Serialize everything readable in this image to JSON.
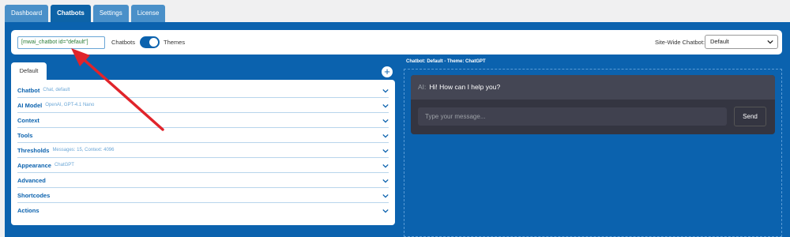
{
  "tabs": [
    {
      "label": "Dashboard",
      "active": false
    },
    {
      "label": "Chatbots",
      "active": true
    },
    {
      "label": "Settings",
      "active": false
    },
    {
      "label": "License",
      "active": false
    }
  ],
  "topbar": {
    "shortcode": "[mwai_chatbot id=\"default\"]",
    "chatbots_label": "Chatbots",
    "themes_label": "Themes",
    "sitewide_label": "Site-Wide Chatbot:",
    "sitewide_value": "Default"
  },
  "editor": {
    "active_tab": "Default",
    "add_symbol": "+",
    "sections": [
      {
        "title": "Chatbot",
        "subtitle": "Chat, default"
      },
      {
        "title": "AI Model",
        "subtitle": "OpenAI, GPT-4.1 Nano"
      },
      {
        "title": "Context",
        "subtitle": ""
      },
      {
        "title": "Tools",
        "subtitle": ""
      },
      {
        "title": "Thresholds",
        "subtitle": "Messages: 15, Context: 4096"
      },
      {
        "title": "Appearance",
        "subtitle": "ChatGPT"
      },
      {
        "title": "Advanced",
        "subtitle": ""
      },
      {
        "title": "Shortcodes",
        "subtitle": ""
      },
      {
        "title": "Actions",
        "subtitle": ""
      }
    ]
  },
  "preview": {
    "label": "Chatbot: Default - Theme: ChatGPT",
    "ai_prefix": "AI:",
    "greeting": "Hi! How can I help you?",
    "input_placeholder": "Type your message...",
    "send_label": "Send"
  },
  "colors": {
    "accent": "#0b62ae",
    "chat_bg": "#343541",
    "arrow": "#e0242b"
  }
}
